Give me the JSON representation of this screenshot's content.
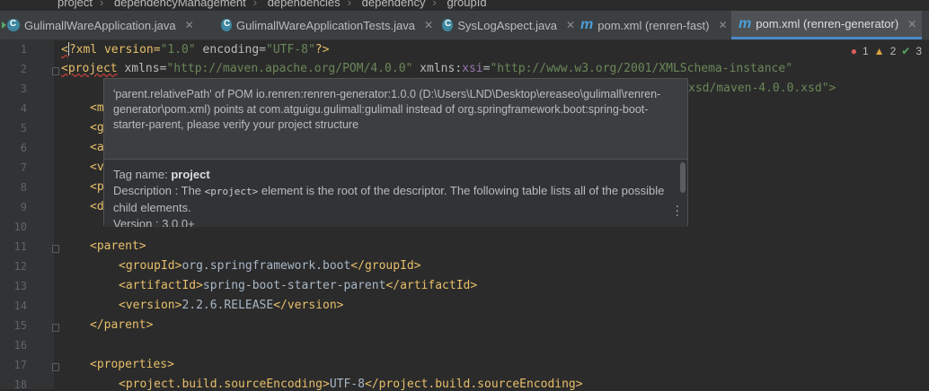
{
  "breadcrumb": [
    "project",
    "dependencyManagement",
    "dependencies",
    "dependency",
    "groupId"
  ],
  "tabs": [
    {
      "label": "GulimallWareApplication.java",
      "icon": "java-class-icon",
      "active": false
    },
    {
      "label": "GulimallWareApplicationTests.java",
      "icon": "java-class-icon",
      "active": false
    },
    {
      "label": "SysLogAspect.java",
      "icon": "java-class-icon",
      "active": false
    },
    {
      "label": "pom.xml (renren-fast)",
      "icon": "maven-icon",
      "active": false
    },
    {
      "label": "pom.xml (renren-generator)",
      "icon": "maven-icon",
      "active": true
    }
  ],
  "inspections": {
    "errors": "1",
    "warnings": "2",
    "ok": "3"
  },
  "line_numbers": [
    "1",
    "2",
    "3",
    "4",
    "5",
    "6",
    "7",
    "8",
    "9",
    "10",
    "11",
    "12",
    "13",
    "14",
    "15",
    "16",
    "17",
    "18"
  ],
  "code": {
    "l1": {
      "lt": "<",
      "decl": "?xml version=",
      "v1": "\"1.0\"",
      "enc": " encoding=",
      "v2": "\"UTF-8\"",
      "end": "?>"
    },
    "l2": {
      "open": "<project",
      "a1": " xmlns=",
      "v1": "\"http://maven.apache.org/POM/4.0.0\"",
      "a2a": " xmlns:",
      "a2b": "xsi",
      "eq": "=",
      "v2": "\"http://www.w3.org/2001/XMLSchema-instance\""
    },
    "l3": {
      "tail": "xsd/maven-4.0.0.xsd\">"
    },
    "l4": "<m",
    "l5": "<g",
    "l6": "<a",
    "l7": "<v",
    "l8": "<p",
    "l9": "<d",
    "l11": "<parent>",
    "l12": {
      "o": "<groupId>",
      "t": "org.springframework.boot",
      "c": "</groupId>"
    },
    "l13": {
      "o": "<artifactId>",
      "t": "spring-boot-starter-parent",
      "c": "</artifactId>"
    },
    "l14": {
      "o": "<version>",
      "t": "2.2.6.RELEASE",
      "c": "</version>"
    },
    "l15": "</parent>",
    "l17": "<properties>",
    "l18": {
      "o": "<project.build.sourceEncoding>",
      "t": "UTF-8",
      "c": "</project.build.sourceEncoding>"
    }
  },
  "popup": {
    "message": "'parent.relativePath' of POM io.renren:renren-generator:1.0.0 (D:\\Users\\LND\\Desktop\\ereaseo\\gulimall\\renren-generator\\pom.xml) points at com.atguigu.gulimall:gulimall instead of org.springframework.boot:spring-boot-starter-parent, please verify your project structure",
    "tag_name_label": "Tag name: ",
    "tag_name": "project",
    "desc_label": "Description : The ",
    "desc_code": "<project>",
    "desc_rest": " element is the root of the descriptor. The following table lists all of the possible child elements.",
    "version_line": "Version : 3.0.0+"
  }
}
